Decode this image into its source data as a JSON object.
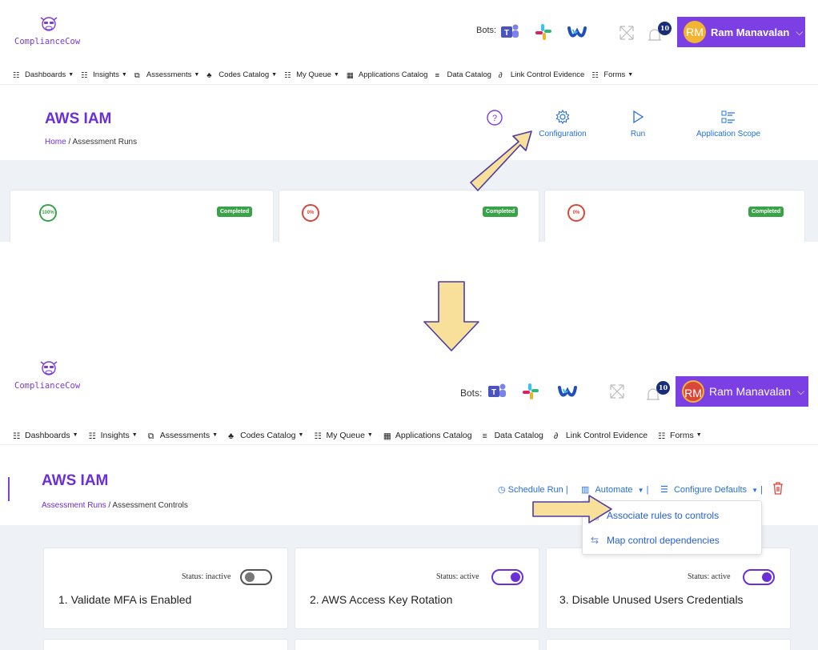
{
  "brand": {
    "name": "ComplianceCow"
  },
  "header": {
    "bots_label": "Bots:",
    "bots": [
      "teams-icon",
      "slack-icon",
      "webex-icon"
    ],
    "notification_count": "10",
    "user": {
      "initials": "RM",
      "name": "Ram Manavalan"
    }
  },
  "nav": [
    {
      "label": "Dashboards",
      "icon": "dashboard-icon",
      "dropdown": true
    },
    {
      "label": "Insights",
      "icon": "insights-icon",
      "dropdown": true
    },
    {
      "label": "Assessments",
      "icon": "assessments-icon",
      "dropdown": true
    },
    {
      "label": "Codes Catalog",
      "icon": "codes-icon",
      "dropdown": true
    },
    {
      "label": "My Queue",
      "icon": "queue-icon",
      "dropdown": true
    },
    {
      "label": "Applications Catalog",
      "icon": "grid-icon",
      "dropdown": false
    },
    {
      "label": "Data Catalog",
      "icon": "list-icon",
      "dropdown": false
    },
    {
      "label": "Link Control Evidence",
      "icon": "link-icon",
      "dropdown": false
    },
    {
      "label": "Forms",
      "icon": "forms-icon",
      "dropdown": true
    }
  ],
  "before": {
    "title": "AWS IAM",
    "breadcrumb": {
      "home": "Home",
      "separator": "/",
      "current": "Assessment Runs"
    },
    "actions": {
      "configuration": "Configuration",
      "run": "Run",
      "application_scope": "Application Scope"
    },
    "runs": [
      {
        "percent": "100%",
        "status": "Completed",
        "color": "#3aa34a"
      },
      {
        "percent": "0%",
        "status": "Completed",
        "color": "#d9473b"
      },
      {
        "percent": "0%",
        "status": "Completed",
        "color": "#d9473b"
      }
    ]
  },
  "after": {
    "title": "AWS IAM",
    "breadcrumb": {
      "parent": "Assessment Runs",
      "separator": "/",
      "current": "Assessment Controls"
    },
    "actions": {
      "schedule_run": "Schedule Run |",
      "automate": "Automate",
      "configure_defaults": "Configure Defaults",
      "pipe": "|"
    },
    "automate_menu": [
      {
        "label": "Associate rules to controls",
        "icon": "rules-icon"
      },
      {
        "label": "Map control dependencies",
        "icon": "dependencies-icon"
      }
    ],
    "controls": [
      {
        "status": "Status: inactive",
        "active": false,
        "title": "1. Validate MFA is Enabled"
      },
      {
        "status": "Status: active",
        "active": true,
        "title": "2. AWS Access Key Rotation"
      },
      {
        "status": "Status: active",
        "active": true,
        "title": "3. Disable Unused Users Credentials"
      }
    ]
  },
  "colors": {
    "accent": "#6b2fd6",
    "link": "#2470e0",
    "arrow_fill": "#f8e09a",
    "arrow_stroke": "#4a3aa8",
    "success": "#3aa34a",
    "danger": "#d9473b"
  }
}
